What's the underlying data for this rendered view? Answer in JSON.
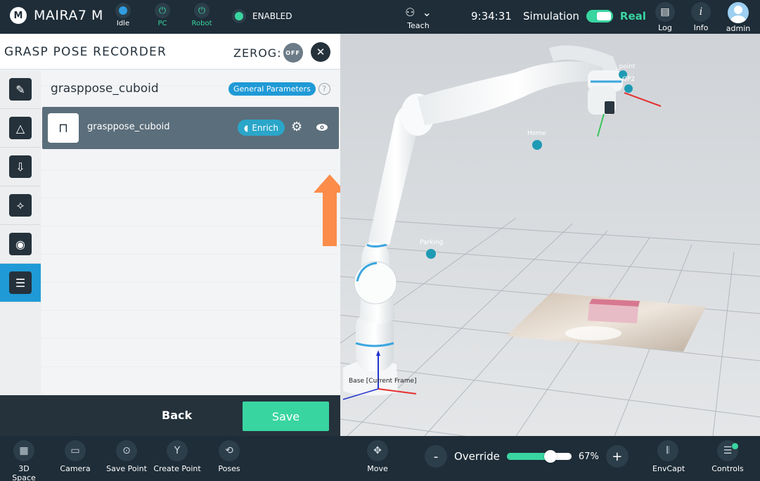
{
  "topbar": {
    "brand": "MAIRA7 M",
    "brand_logo": "M",
    "status_idle": "Idle",
    "status_pc": "PC",
    "status_robot": "Robot",
    "enabled": "ENABLED",
    "teach": "Teach",
    "time": "9:34:31",
    "simulation": "Simulation",
    "real": "Real",
    "log": "Log",
    "info": "Info",
    "user": "admin"
  },
  "panel": {
    "title": "GRASP POSE RECORDER",
    "zerog_label": "ZEROG:",
    "zerog_state": "OFF",
    "task_title": "grasppose_cuboid",
    "general_parameters": "General Parameters",
    "help": "?",
    "item": {
      "label": "grasppose_cuboid",
      "enrich": "Enrich"
    },
    "back": "Back",
    "save": "Save"
  },
  "viewport": {
    "labels": {
      "point": "_point",
      "gp2": "GP2",
      "home": "Home",
      "parking": "Parking",
      "base": "Base [Current Frame]"
    }
  },
  "bottombar": {
    "space_3d": "3D Space",
    "camera": "Camera",
    "save_point": "Save Point",
    "create_point": "Create Point",
    "poses": "Poses",
    "move": "Move",
    "override_minus": "-",
    "override": "Override",
    "override_value": 0.67,
    "override_pct": "67%",
    "override_plus": "+",
    "envcapt": "EnvCapt",
    "controls": "Controls"
  },
  "colors": {
    "accent": "#39d5a0",
    "blue": "#1f9ad6",
    "dark": "#1e2d38",
    "card": "#5b6e7b",
    "arrow": "#fb8c4a"
  }
}
